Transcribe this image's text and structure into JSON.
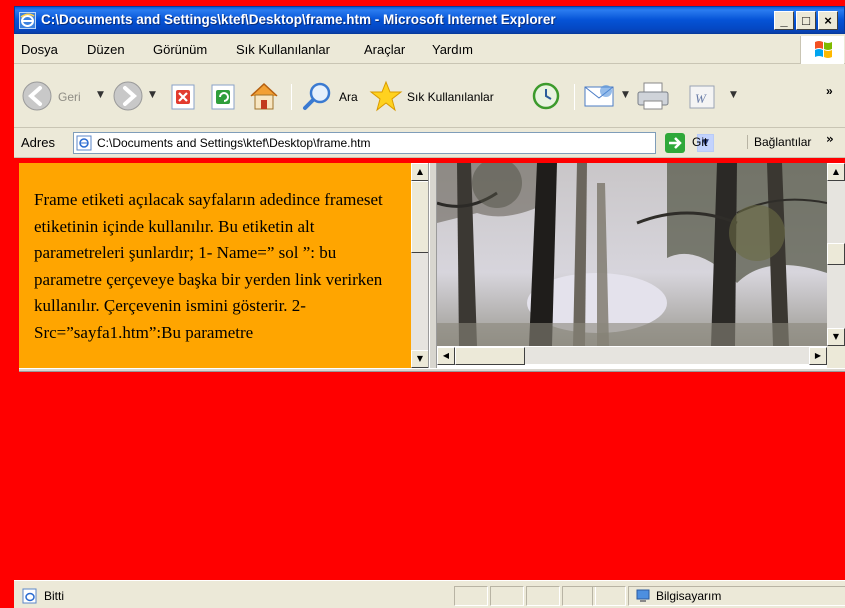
{
  "window": {
    "title": "C:\\Documents and Settings\\ktef\\Desktop\\frame.htm - Microsoft Internet Explorer",
    "minimize": "_",
    "maximize": "□",
    "close": "×"
  },
  "menu": {
    "items": [
      "Dosya",
      "Düzen",
      "Görünüm",
      "Sık Kullanılanlar",
      "Araçlar",
      "Yardım"
    ]
  },
  "toolbar": {
    "back_label": "Geri",
    "search_label": "Ara",
    "favorites_label": "Sık Kullanılanlar",
    "more_chevron": "»"
  },
  "address": {
    "label": "Adres",
    "value": "C:\\Documents and Settings\\ktef\\Desktop\\frame.htm",
    "go_label": "Git",
    "links_label": "Bağlantılar",
    "links_chevron": "»"
  },
  "frames": {
    "left_text": "Frame etiketi açılacak sayfaların adedince frameset etiketinin içinde kullanılır. Bu etiketin alt parametreleri şunlardır; 1- Name=” sol ”: bu parametre çerçeveye başka bir yerden link verirken kullanılır. Çerçevenin ismini gösterir. 2- Src=”sayfa1.htm”:Bu parametre",
    "left_background": "#ffa500",
    "bottom_background": "#ff0000"
  },
  "status": {
    "text": "Bitti",
    "zone": "Bilgisayarım"
  },
  "icons": {
    "title": "ie-logo-icon",
    "back": "back-arrow-icon",
    "forward": "forward-arrow-icon",
    "stop": "stop-icon",
    "refresh": "refresh-icon",
    "home": "home-icon",
    "search": "search-magnifier-icon",
    "favorites": "favorites-star-icon",
    "history": "history-icon",
    "mail": "mail-icon",
    "print": "print-icon",
    "edit": "word-edit-icon",
    "go": "go-arrow-icon",
    "status": "page-done-icon",
    "zone": "my-computer-icon"
  }
}
